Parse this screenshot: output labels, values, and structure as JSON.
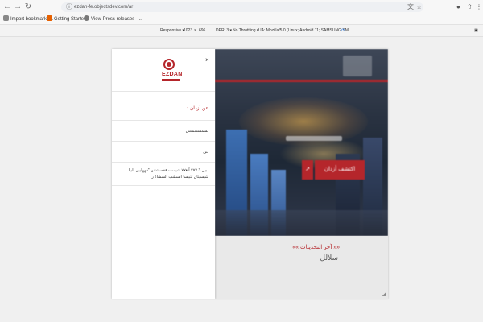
{
  "browser": {
    "url": "ezdan-fe.objectsdev.com/ar",
    "bookmarks": [
      "Import bookmarks...",
      "Getting Started",
      "View Press releases -..."
    ]
  },
  "devtools": {
    "device": "Responsive ▾",
    "width": "1023",
    "times": "×",
    "height": "696",
    "dpr": "DPR: 3 ▾",
    "throttle": "No Throttling ▾",
    "ua": "UA: Mozilla/5.0 (Linux; Android 11; SAMSUNG SM"
  },
  "side_menu": {
    "close": "×",
    "back_label": "عن أزدان",
    "items": [
      "بسمششمنش",
      "تنن",
      "لبيل 3 ٧٧٧ آ••٧٧ شيست ققسشتنن \"فههايين البيا",
      "شيسيتان تتبيسا انسشب السشاء ر"
    ]
  },
  "hero": {
    "cta_label": "اكتشف أزدان",
    "cta_icon": "↗"
  },
  "news": {
    "title": "«« آخر التحديثات »»",
    "subtitle": "سلالل"
  },
  "colors": {
    "accent": "#b5262b",
    "hero_dark": "#2a3342",
    "tower_blue": "#3d6fb2"
  }
}
